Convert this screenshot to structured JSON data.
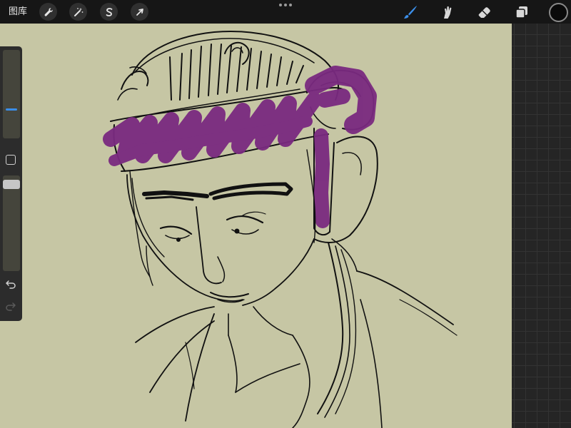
{
  "topbar": {
    "gallery_label": "图库",
    "left_tools": [
      {
        "name": "actions",
        "icon": "wrench-icon"
      },
      {
        "name": "adjustments",
        "icon": "magic-wand-icon"
      },
      {
        "name": "selection",
        "icon": "selection-s-icon"
      },
      {
        "name": "transform",
        "icon": "arrow-cursor-icon"
      }
    ],
    "right_tools": [
      {
        "name": "brush",
        "icon": "brush-icon",
        "active": true
      },
      {
        "name": "smudge",
        "icon": "smudge-finger-icon",
        "active": false
      },
      {
        "name": "eraser",
        "icon": "eraser-icon",
        "active": false
      },
      {
        "name": "layers",
        "icon": "layers-icon",
        "active": false
      }
    ],
    "current_color": "#0a0a0a"
  },
  "sidebar": {
    "brush_size_level": 0.32,
    "opacity_level": 0.95,
    "undo_icon": "undo-icon",
    "redo_icon": "redo-icon"
  },
  "colors": {
    "canvas": "#c6c6a4",
    "accent": "#3b8ee8",
    "headband": "#7a2a80",
    "ink": "#111111"
  }
}
